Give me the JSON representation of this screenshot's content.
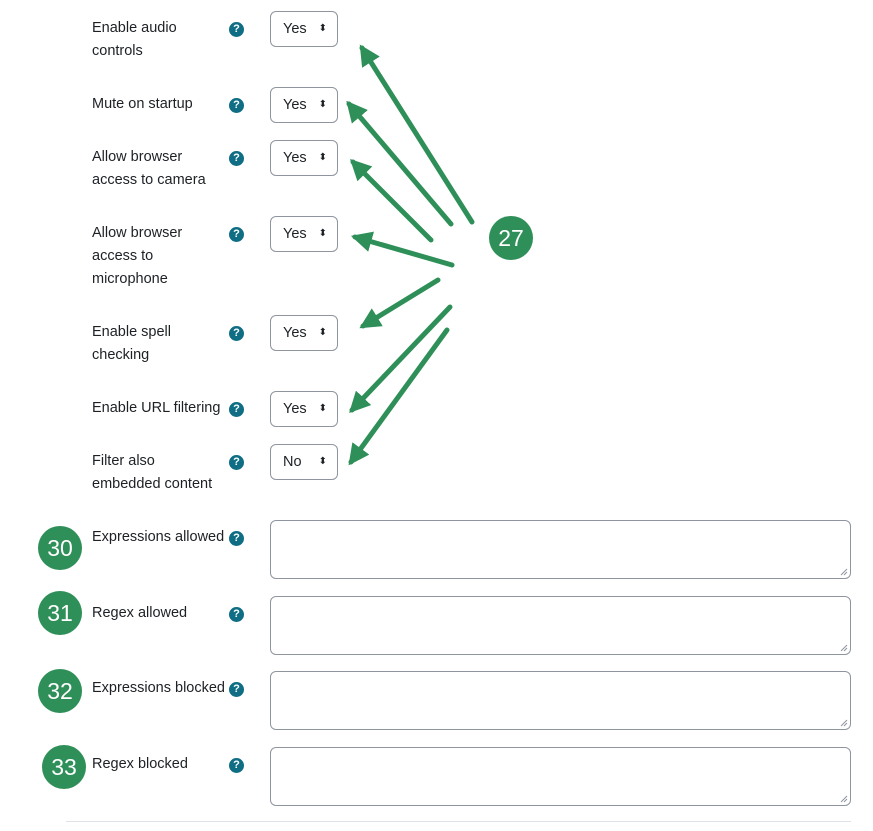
{
  "settings": [
    {
      "label": "Enable audio controls",
      "value": "Yes"
    },
    {
      "label": "Mute on startup",
      "value": "Yes"
    },
    {
      "label": "Allow browser access to camera",
      "value": "Yes"
    },
    {
      "label": "Allow browser access to microphone",
      "value": "Yes"
    },
    {
      "label": "Enable spell checking",
      "value": "Yes"
    },
    {
      "label": "Enable URL filtering",
      "value": "Yes"
    },
    {
      "label": "Filter also embedded content",
      "value": "No"
    }
  ],
  "text_fields": [
    {
      "label": "Expressions allowed",
      "value": ""
    },
    {
      "label": "Regex allowed",
      "value": ""
    },
    {
      "label": "Expressions blocked",
      "value": ""
    },
    {
      "label": "Regex blocked",
      "value": ""
    }
  ],
  "annotations": {
    "callout_main": "27",
    "callout_expressions_allowed": "30",
    "callout_regex_allowed": "31",
    "callout_expressions_blocked": "32",
    "callout_regex_blocked": "33"
  },
  "help_icon_glyph": "?",
  "select_caret_glyph": "◆",
  "colors": {
    "annotation_green": "#2f8f58",
    "help_icon": "#0f6e84",
    "border": "#8f959e"
  }
}
